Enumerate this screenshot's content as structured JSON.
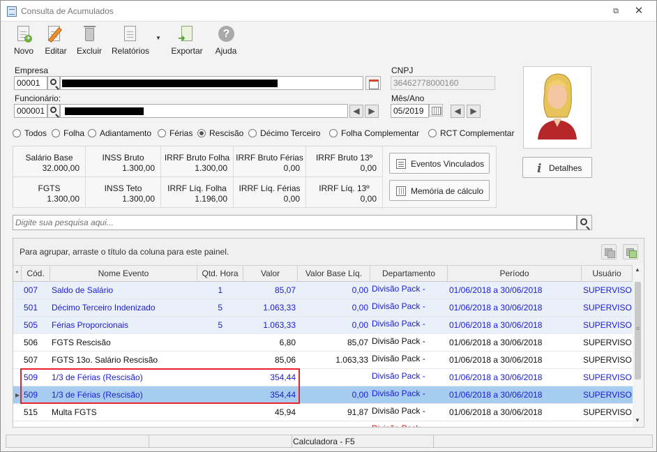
{
  "window": {
    "title": "Consulta de Acumulados"
  },
  "toolbar": {
    "novo": "Novo",
    "editar": "Editar",
    "excluir": "Excluir",
    "relatorios": "Relatórios",
    "exportar": "Exportar",
    "ajuda": "Ajuda"
  },
  "form": {
    "empresa_label": "Empresa",
    "empresa_code": "00001",
    "cnpj_label": "CNPJ",
    "cnpj_value": "36462778000160",
    "funcionario_label": "Funcionário:",
    "funcionario_code": "000001",
    "mesano_label": "Mês/Ano",
    "mesano_value": "05/2019"
  },
  "radios": [
    {
      "label": "Todos",
      "selected": false
    },
    {
      "label": "Folha",
      "selected": false
    },
    {
      "label": "Adiantamento",
      "selected": false
    },
    {
      "label": "Férias",
      "selected": false
    },
    {
      "label": "Rescisão",
      "selected": true
    },
    {
      "label": "Décimo Terceiro",
      "selected": false
    },
    {
      "label": "Folha Complementar",
      "selected": false
    },
    {
      "label": "RCT Complementar",
      "selected": false
    }
  ],
  "summary": [
    {
      "title": "Salário Base",
      "value": "32.000,00"
    },
    {
      "title": "INSS Bruto",
      "value": "1.300,00"
    },
    {
      "title": "IRRF Bruto Folha",
      "value": "1.300,00"
    },
    {
      "title": "IRRF Bruto Férias",
      "value": "0,00"
    },
    {
      "title": "IRRF Bruto 13º",
      "value": "0,00"
    },
    {
      "title": "FGTS",
      "value": "1.300,00"
    },
    {
      "title": "INSS Teto",
      "value": "1.300,00"
    },
    {
      "title": "IRRF Líq. Folha",
      "value": "1.196,00"
    },
    {
      "title": "IRRF Líq. Férias",
      "value": "0,00"
    },
    {
      "title": "IRRF Líq. 13º",
      "value": "0,00"
    }
  ],
  "buttons": {
    "eventos": "Eventos Vinculados",
    "memoria": "Memória de cálculo",
    "detalhes": "Detalhes"
  },
  "search": {
    "placeholder": "Digite sua pesquisa aqui..."
  },
  "grid": {
    "group_hint": "Para agrupar, arraste o título da coluna para este painel.",
    "columns": [
      "Cód.",
      "Nome Evento",
      "Qtd. Hora",
      "Valor",
      "Valor Base Líq.",
      "Departamento",
      "Período",
      "Usuário"
    ],
    "rows": [
      {
        "cod": "007",
        "nome": "Saldo de Salário",
        "qtd": "1",
        "valor": "85,07",
        "base": "0,00",
        "dep": "Divisão Pack -",
        "periodo": "01/06/2018 a 30/06/2018",
        "usuario": "SUPERVISOR",
        "color": "#1a1ad6"
      },
      {
        "cod": "501",
        "nome": "Décimo Terceiro Indenizado",
        "qtd": "5",
        "valor": "1.063,33",
        "base": "0,00",
        "dep": "Divisão Pack -",
        "periodo": "01/06/2018 a 30/06/2018",
        "usuario": "SUPERVISOR",
        "color": "#1a1ad6"
      },
      {
        "cod": "505",
        "nome": "Férias Proporcionais",
        "qtd": "5",
        "valor": "1.063,33",
        "base": "0,00",
        "dep": "Divisão Pack -",
        "periodo": "01/06/2018 a 30/06/2018",
        "usuario": "SUPERVISOR",
        "color": "#1a1ad6"
      },
      {
        "cod": "506",
        "nome": "FGTS Rescisão",
        "qtd": "",
        "valor": "6,80",
        "base": "85,07",
        "dep": "Divisão Pack -",
        "periodo": "01/06/2018 a 30/06/2018",
        "usuario": "SUPERVISOR",
        "color": "#111111"
      },
      {
        "cod": "507",
        "nome": "FGTS 13o. Salário Rescisão",
        "qtd": "",
        "valor": "85,06",
        "base": "1.063,33",
        "dep": "Divisão Pack -",
        "periodo": "01/06/2018 a 30/06/2018",
        "usuario": "SUPERVISOR",
        "color": "#111111"
      },
      {
        "cod": "509",
        "nome": "1/3 de Férias (Rescisão)",
        "qtd": "",
        "valor": "354,44",
        "base": "",
        "dep": "Divisão Pack -",
        "periodo": "01/06/2018 a 30/06/2018",
        "usuario": "SUPERVISOR",
        "color": "#1a1ad6"
      },
      {
        "cod": "509",
        "nome": "1/3 de Férias (Rescisão)",
        "qtd": "",
        "valor": "354,44",
        "base": "0,00",
        "dep": "Divisão Pack -",
        "periodo": "01/06/2018 a 30/06/2018",
        "usuario": "SUPERVISOR",
        "color": "#1a1ad6"
      },
      {
        "cod": "515",
        "nome": "Multa FGTS",
        "qtd": "",
        "valor": "45,94",
        "base": "91,87",
        "dep": "Divisão Pack -",
        "periodo": "01/06/2018 a 30/06/2018",
        "usuario": "SUPERVISOR",
        "color": "#111111"
      },
      {
        "cod": "",
        "nome": "",
        "qtd": "",
        "valor": "",
        "base": "",
        "dep": "Divisão Pack -",
        "periodo": "",
        "usuario": "",
        "color": "#d01818"
      }
    ]
  },
  "status": {
    "calc": "Calculadora - F5"
  }
}
